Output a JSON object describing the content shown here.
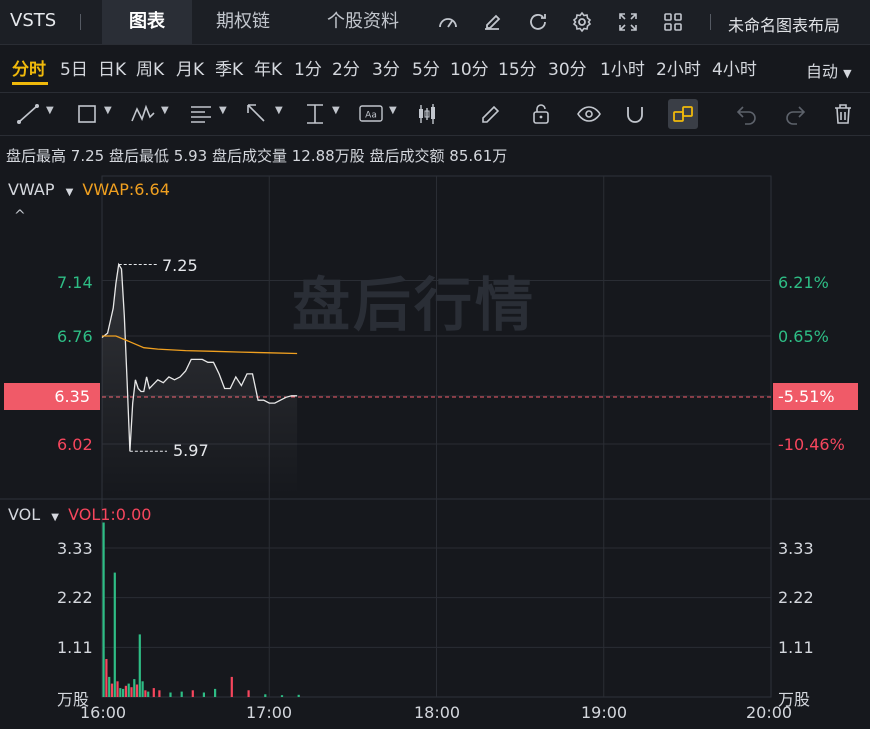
{
  "header": {
    "ticker": "VSTS",
    "tabs": [
      "图表",
      "期权链",
      "个股资料"
    ],
    "layout_name": "未命名图表布局"
  },
  "periods": {
    "items": [
      "分时",
      "5日",
      "日K",
      "周K",
      "月K",
      "季K",
      "年K",
      "1分",
      "2分",
      "3分",
      "5分",
      "10分",
      "15分",
      "30分",
      "1小时",
      "2小时",
      "4小时"
    ],
    "active": "分时",
    "mode": "自动"
  },
  "toolbar": {
    "tools": [
      "line-tool",
      "rectangle-tool",
      "pattern-tool",
      "fib-tool",
      "arrow-tool",
      "measure-tool",
      "text-tool",
      "candle-tool",
      "pencil-tool",
      "lock-tool",
      "eye-tool",
      "magnet-tool",
      "link-tool",
      "undo-tool",
      "redo-tool",
      "delete-tool"
    ],
    "active_tool": "link-tool"
  },
  "stats": {
    "high_label": "盘后最高",
    "high": "7.25",
    "low_label": "盘后最低",
    "low": "5.93",
    "vol_label": "盘后成交量",
    "vol": "12.88万股",
    "amt_label": "盘后成交额",
    "amt": "85.61万"
  },
  "price_panel": {
    "indicator": "VWAP",
    "indicator_value": "VWAP:6.64",
    "watermark": "盘后行情",
    "y_left": [
      "7.14",
      "6.76",
      "6.35",
      "6.02"
    ],
    "y_right": [
      "6.21%",
      "0.65%",
      "-5.51%",
      "-10.46%"
    ],
    "max_label": "7.25",
    "min_label": "5.97",
    "current_price": "6.35",
    "current_pct": "-5.51%"
  },
  "volume_panel": {
    "indicator": "VOL",
    "indicator_value": "VOL1:0.00",
    "y_ticks": [
      "3.33",
      "2.22",
      "1.11"
    ],
    "unit": "万股"
  },
  "x_axis": [
    "16:00",
    "17:00",
    "18:00",
    "19:00",
    "20:00"
  ],
  "colors": {
    "up": "#2ebd85",
    "down": "#f6465d",
    "vwap": "#f0a020",
    "price": "#e8e8e8",
    "accent": "#f0b90b"
  },
  "chart_data": [
    {
      "type": "line",
      "title": "",
      "x_unit": "time",
      "series": [
        {
          "name": "",
          "x": [
            "16:00",
            "16:02",
            "16:04",
            "16:05",
            "16:06",
            "16:07",
            "16:08",
            "16:09",
            "16:10",
            "16:11",
            "16:12",
            "16:13",
            "16:14",
            "16:15",
            "16:16",
            "16:17",
            "16:18",
            "16:20",
            "16:22",
            "16:24",
            "16:26",
            "16:28",
            "16:30",
            "16:32",
            "16:34",
            "16:36",
            "16:38",
            "16:40",
            "16:42",
            "16:44",
            "16:46",
            "16:48",
            "16:50",
            "16:52",
            "16:54",
            "16:56",
            "16:58",
            "17:00",
            "17:02",
            "17:04",
            "17:06",
            "17:08",
            "17:10"
          ],
          "values": [
            6.75,
            6.78,
            6.95,
            7.12,
            7.25,
            7.22,
            6.9,
            6.45,
            5.97,
            6.3,
            6.46,
            6.4,
            6.38,
            6.38,
            6.48,
            6.4,
            6.42,
            6.46,
            6.44,
            6.48,
            6.46,
            6.48,
            6.52,
            6.6,
            6.6,
            6.6,
            6.58,
            6.58,
            6.5,
            6.4,
            6.4,
            6.48,
            6.42,
            6.5,
            6.5,
            6.32,
            6.32,
            6.3,
            6.3,
            6.32,
            6.34,
            6.35,
            6.35
          ]
        },
        {
          "name": "VWAP",
          "x": [
            "16:00",
            "16:05",
            "16:10",
            "16:15",
            "16:20",
            "16:30",
            "16:40",
            "16:50",
            "17:00",
            "17:10"
          ],
          "values": [
            6.76,
            6.76,
            6.72,
            6.68,
            6.67,
            6.66,
            6.655,
            6.65,
            6.645,
            6.64
          ]
        }
      ],
      "ylim": [
        5.93,
        7.3
      ],
      "xlim": [
        "16:00",
        "20:00"
      ],
      "y_ticks": [
        7.14,
        6.76,
        6.35,
        6.02
      ]
    },
    {
      "type": "bar",
      "title": "",
      "ylabel": "万股",
      "ylim": [
        0,
        3.9
      ],
      "bars": [
        {
          "x": "16:00",
          "value": 3.9,
          "dir": "up"
        },
        {
          "x": "16:01",
          "value": 0.85,
          "dir": "down"
        },
        {
          "x": "16:02",
          "value": 0.45,
          "dir": "up"
        },
        {
          "x": "16:03",
          "value": 0.3,
          "dir": "down"
        },
        {
          "x": "16:04",
          "value": 2.78,
          "dir": "up"
        },
        {
          "x": "16:05",
          "value": 0.35,
          "dir": "down"
        },
        {
          "x": "16:06",
          "value": 0.2,
          "dir": "up"
        },
        {
          "x": "16:07",
          "value": 0.18,
          "dir": "up"
        },
        {
          "x": "16:08",
          "value": 0.25,
          "dir": "down"
        },
        {
          "x": "16:09",
          "value": 0.3,
          "dir": "up"
        },
        {
          "x": "16:10",
          "value": 0.22,
          "dir": "down"
        },
        {
          "x": "16:11",
          "value": 0.4,
          "dir": "up"
        },
        {
          "x": "16:12",
          "value": 0.28,
          "dir": "down"
        },
        {
          "x": "16:13",
          "value": 1.4,
          "dir": "up"
        },
        {
          "x": "16:14",
          "value": 0.35,
          "dir": "up"
        },
        {
          "x": "16:15",
          "value": 0.15,
          "dir": "down"
        },
        {
          "x": "16:16",
          "value": 0.12,
          "dir": "up"
        },
        {
          "x": "16:18",
          "value": 0.2,
          "dir": "down"
        },
        {
          "x": "16:20",
          "value": 0.15,
          "dir": "down"
        },
        {
          "x": "16:24",
          "value": 0.1,
          "dir": "up"
        },
        {
          "x": "16:28",
          "value": 0.12,
          "dir": "up"
        },
        {
          "x": "16:32",
          "value": 0.15,
          "dir": "down"
        },
        {
          "x": "16:36",
          "value": 0.1,
          "dir": "up"
        },
        {
          "x": "16:40",
          "value": 0.18,
          "dir": "up"
        },
        {
          "x": "16:46",
          "value": 0.45,
          "dir": "down"
        },
        {
          "x": "16:52",
          "value": 0.15,
          "dir": "down"
        },
        {
          "x": "16:58",
          "value": 0.06,
          "dir": "up"
        },
        {
          "x": "17:04",
          "value": 0.04,
          "dir": "up"
        },
        {
          "x": "17:10",
          "value": 0.05,
          "dir": "up"
        }
      ]
    }
  ]
}
